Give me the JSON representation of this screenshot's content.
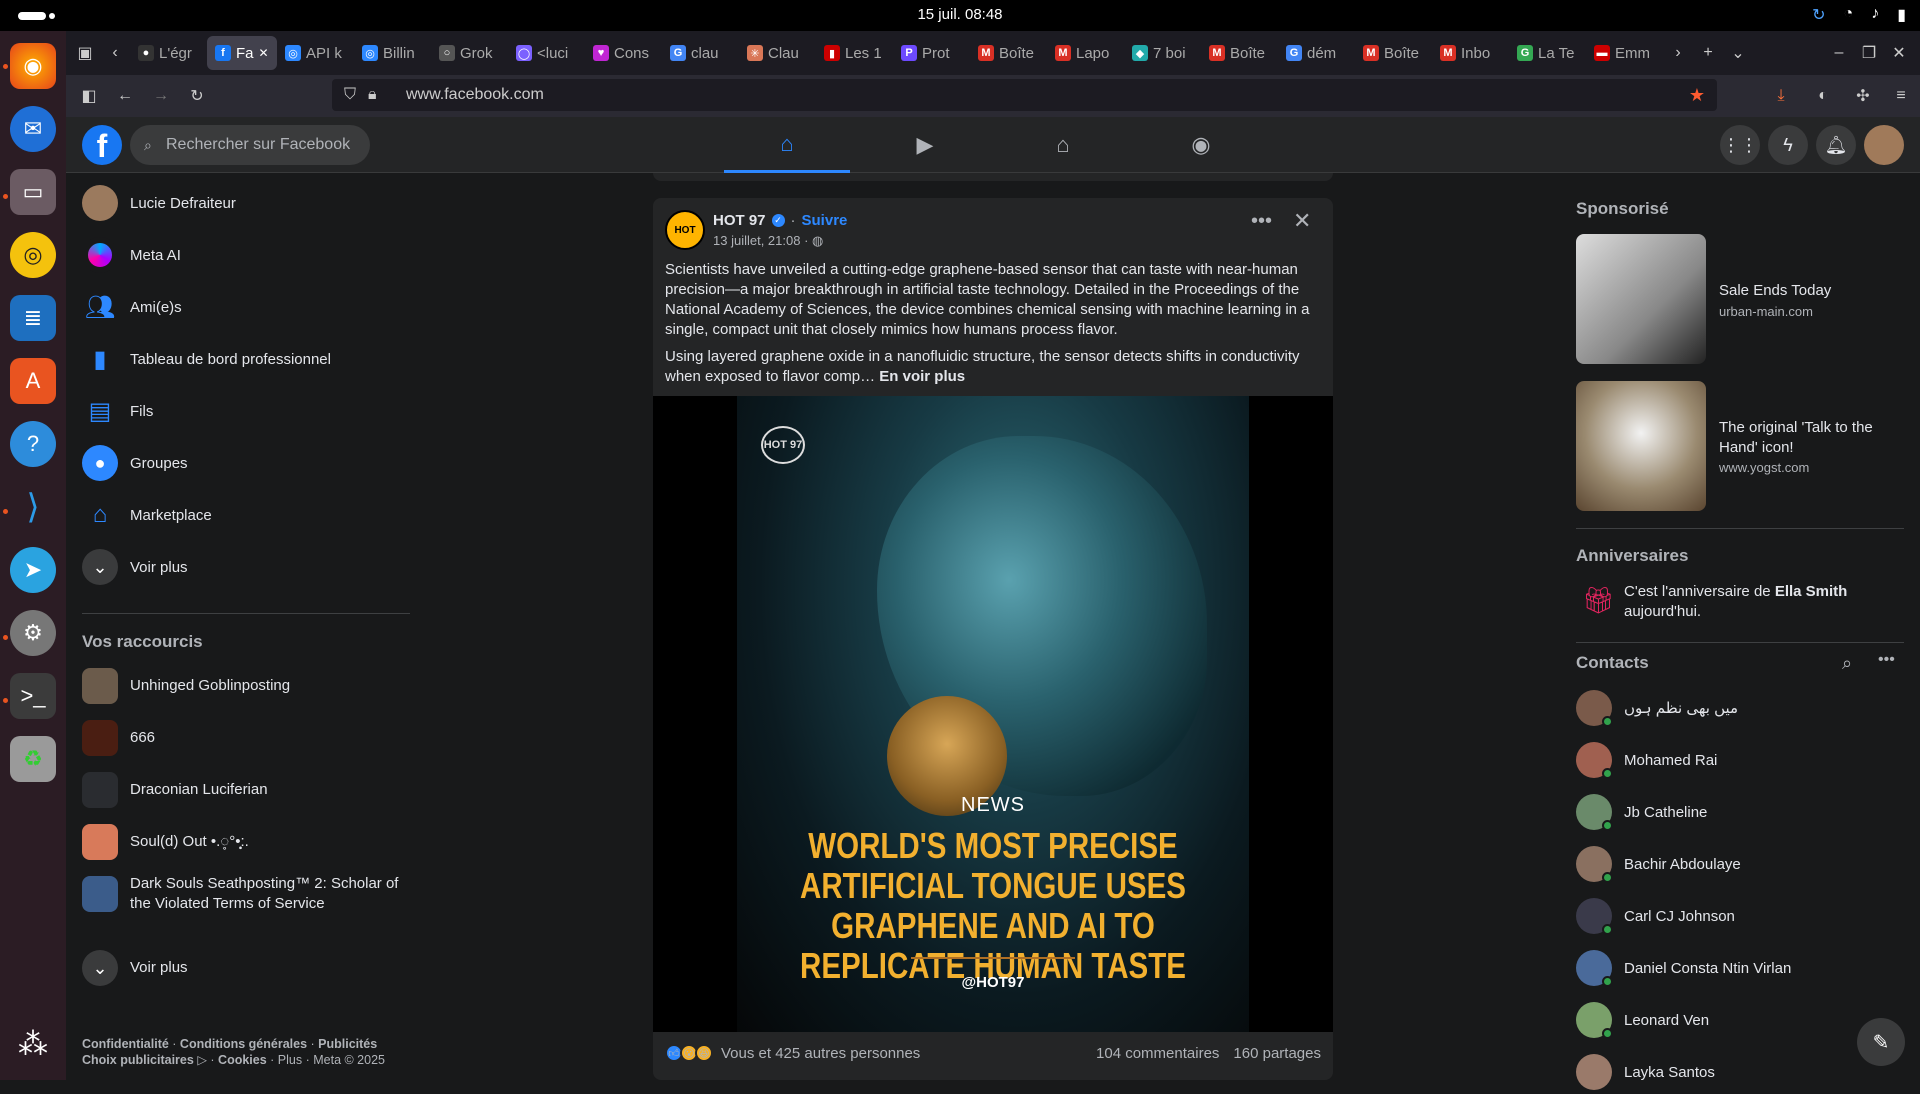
{
  "system": {
    "clock": "15 juil.  08:48"
  },
  "browser": {
    "tabs": [
      {
        "label": "L'égr",
        "fav": "●",
        "color": "#333"
      },
      {
        "label": "Fa",
        "fav": "f",
        "color": "#1877f2",
        "active": true
      },
      {
        "label": "API k",
        "fav": "◎",
        "color": "#2d88ff"
      },
      {
        "label": "Billin",
        "fav": "◎",
        "color": "#2d88ff"
      },
      {
        "label": "Grok",
        "fav": "○",
        "color": "#555"
      },
      {
        "label": "<luci",
        "fav": "◯",
        "color": "#7b61ff"
      },
      {
        "label": "Cons",
        "fav": "♥",
        "color": "#c026d3"
      },
      {
        "label": "clau",
        "fav": "G",
        "color": "#4285f4"
      },
      {
        "label": "Clau",
        "fav": "✳",
        "color": "#d97757"
      },
      {
        "label": "Les 1",
        "fav": "▮",
        "color": "#c00"
      },
      {
        "label": "Prot",
        "fav": "P",
        "color": "#6d4aff"
      },
      {
        "label": "Boîte",
        "fav": "M",
        "color": "#d93025"
      },
      {
        "label": "Lapo",
        "fav": "M",
        "color": "#d93025"
      },
      {
        "label": "7 boi",
        "fav": "◆",
        "color": "#2aa"
      },
      {
        "label": "Boîte",
        "fav": "M",
        "color": "#d93025"
      },
      {
        "label": "dém",
        "fav": "G",
        "color": "#4285f4"
      },
      {
        "label": "Boîte",
        "fav": "M",
        "color": "#d93025"
      },
      {
        "label": "Inbo",
        "fav": "M",
        "color": "#d93025"
      },
      {
        "label": "La Te",
        "fav": "G",
        "color": "#34a853"
      },
      {
        "label": "Emm",
        "fav": "▬",
        "color": "#c00"
      }
    ],
    "url": "www.facebook.com"
  },
  "fb": {
    "search_placeholder": "Rechercher sur Facebook",
    "left_menu": [
      {
        "label": "Lucie Defraiteur",
        "icon": "avatar"
      },
      {
        "label": "Meta AI",
        "icon": "meta-ai-icon"
      },
      {
        "label": "Ami(e)s",
        "icon": "friends-icon"
      },
      {
        "label": "Tableau de bord professionnel",
        "icon": "dashboard-icon"
      },
      {
        "label": "Fils",
        "icon": "feeds-icon"
      },
      {
        "label": "Groupes",
        "icon": "groups-icon"
      },
      {
        "label": "Marketplace",
        "icon": "marketplace-icon"
      },
      {
        "label": "Voir plus",
        "icon": "chevron-down-icon"
      }
    ],
    "shortcuts_title": "Vos raccourcis",
    "shortcuts": [
      {
        "label": "Unhinged Goblinposting"
      },
      {
        "label": "666"
      },
      {
        "label": "Draconian Luciferian"
      },
      {
        "label": "Soul(d) Out •.◌̥°•̥̩:."
      },
      {
        "label": "Dark Souls Seathposting™ 2: Scholar of the Violated Terms of Service"
      },
      {
        "label": "Voir plus"
      }
    ],
    "footer": {
      "l1": "Confidentialité",
      "l2": "Conditions générales",
      "l3": "Publicités",
      "l4": "Choix publicitaires",
      "l5": "Cookies",
      "l6": "Plus",
      "l7": "Meta © 2025"
    },
    "post": {
      "author": "HOT 97",
      "follow": "Suivre",
      "date": "13 juillet, 21:08 ·",
      "para1": "Scientists have unveiled a cutting-edge graphene-based sensor that can taste with near-human precision—a major breakthrough in artificial taste technology. Detailed in the Proceedings of the National Academy of Sciences, the device combines chemical sensing with machine learning in a single, compact unit that closely mimics how humans process flavor.",
      "para2": "Using layered graphene oxide in a nanofluidic structure, the sensor detects shifts in conductivity when exposed to flavor comp…",
      "see_more": "En voir plus",
      "image": {
        "logo": "HOT 97",
        "label": "NEWS",
        "headline": "WORLD'S MOST PRECISE ARTIFICIAL TONGUE USES GRAPHENE AND AI TO REPLICATE HUMAN TASTE",
        "handle": "@HOT97"
      },
      "reactions": "Vous et 425 autres personnes",
      "comments": "104 commentaires",
      "shares": "160 partages"
    },
    "right": {
      "sponsored_title": "Sponsorisé",
      "ads": [
        {
          "title": "Sale Ends Today",
          "url": "urban-main.com"
        },
        {
          "title": "The original 'Talk to the Hand' icon!",
          "url": "www.yogst.com"
        }
      ],
      "birthdays_title": "Anniversaires",
      "birthday_pre": "C'est l'anniversaire de ",
      "birthday_name": "Ella Smith",
      "birthday_post": " aujourd'hui.",
      "contacts_title": "Contacts",
      "contacts": [
        {
          "name": "میں بھی نظم ہوں",
          "online": true
        },
        {
          "name": "Mohamed Rai",
          "online": true
        },
        {
          "name": "Jb Catheline",
          "online": true
        },
        {
          "name": "Bachir Abdoulaye",
          "online": true
        },
        {
          "name": "Carl CJ Johnson",
          "online": true
        },
        {
          "name": "Daniel Consta Ntin Virlan",
          "online": true
        },
        {
          "name": "Leonard Ven",
          "online": true
        },
        {
          "name": "Layka Santos",
          "online": false
        }
      ]
    }
  }
}
